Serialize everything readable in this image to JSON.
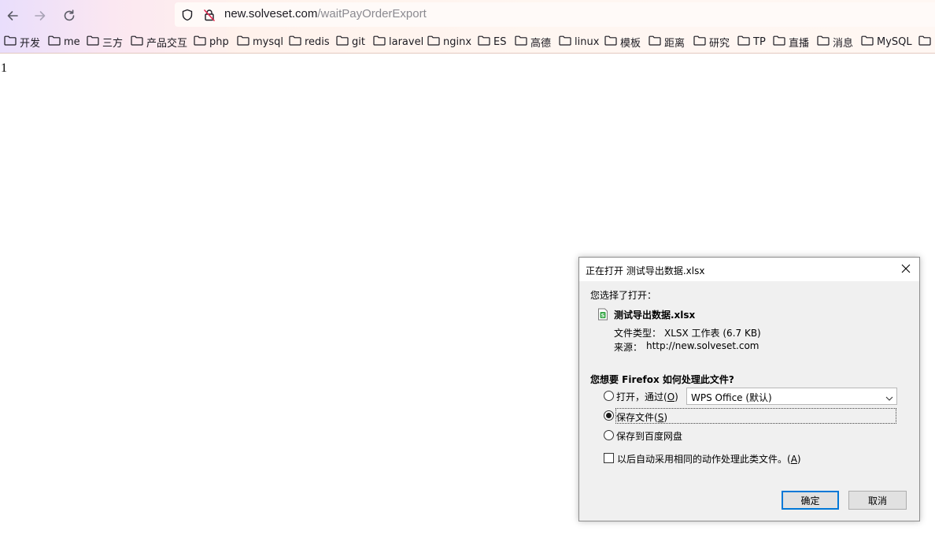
{
  "browser": {
    "url_host": "new.solveset.com",
    "url_path": "/waitPayOrderExport",
    "bookmarks": [
      "开发",
      "me",
      "三方",
      "产品交互",
      "php",
      "mysql",
      "redis",
      "git",
      "laravel",
      "nginx",
      "ES",
      "高德",
      "linux",
      "模板",
      "距离",
      "研究",
      "TP",
      "直播",
      "消息",
      "MySQL",
      ""
    ]
  },
  "page": {
    "body_text": "1"
  },
  "dialog": {
    "title": "正在打开 测试导出数据.xlsx",
    "intro": "您选择了打开：",
    "file_name": "测试导出数据.xlsx",
    "type_label": "文件类型：",
    "type_value": "XLSX 工作表 (6.7 KB)",
    "source_label": "来源：",
    "source_value": "http://new.solveset.com",
    "question": "您想要 Firefox 如何处理此文件?",
    "open_with_label": "打开，通过(",
    "open_with_key": "O",
    "open_with_tail": ")",
    "app_select_value": "WPS Office (默认)",
    "save_label": "保存文件(",
    "save_key": "S",
    "save_tail": ")",
    "selected_option": "save",
    "baidu_label": "保存到百度网盘",
    "remember_label": "以后自动采用相同的动作处理此类文件。(",
    "remember_key": "A",
    "remember_tail": ")",
    "remember_checked": false,
    "ok_label": "确定",
    "cancel_label": "取消"
  },
  "colors": {
    "accent": "#0078d7",
    "file_icon": "#3aa84a"
  }
}
